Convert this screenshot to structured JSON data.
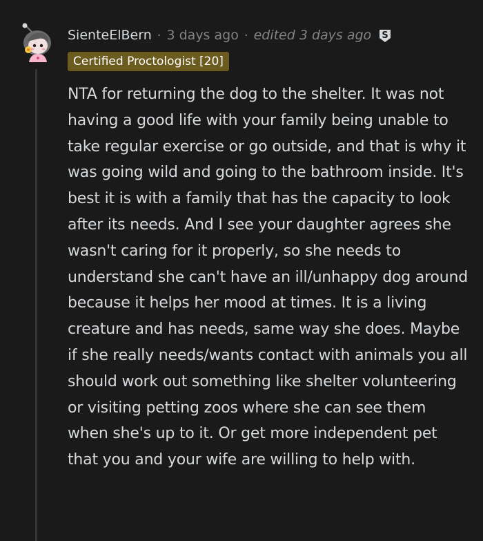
{
  "comment": {
    "username": "SienteElBern",
    "separator": "·",
    "posted": "3 days ago",
    "edited": "edited 3 days ago",
    "flair": "Certified Proctologist [20]",
    "body": "NTA for returning the dog to the shelter. It was not having a good life with your family being unable to take regular exercise or go outside, and that is why it was going wild and going to the bathroom inside. It's best it is with a family that has the capacity to look after its needs. And I see your daughter agrees she wasn't caring for it properly, so she needs to understand she can't have an ill/unhappy dog around because it helps her mood at times. It is a living creature and has needs, same way she does. Maybe if she really needs/wants contact with animals you all should work out something like shelter volunteering or visiting petting zoos where she can see them when she's up to it. Or get more independent pet that you and your wife are willing to help with."
  },
  "icons": {
    "avatar": "snoo-avatar-icon",
    "badge": "award-badge-icon"
  },
  "colors": {
    "background": "#1a1a1b",
    "text": "#d7dadc",
    "meta": "#818384",
    "flair_bg": "#6b5b1e",
    "thread_line": "#343536"
  }
}
